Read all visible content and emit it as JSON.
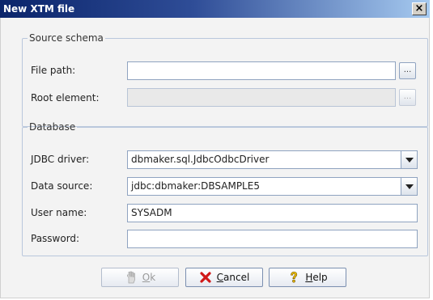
{
  "window": {
    "title": "New XTM file",
    "close_label": "×"
  },
  "source_schema": {
    "legend": "Source schema",
    "file_path_label": "File path:",
    "file_path_value": "",
    "root_element_label": "Root element:",
    "root_element_value": "",
    "browse_label": "..."
  },
  "database": {
    "legend": "Database",
    "jdbc_driver_label": "JDBC driver:",
    "jdbc_driver_value": "dbmaker.sql.JdbcOdbcDriver",
    "data_source_label": "Data source:",
    "data_source_value": "jdbc:dbmaker:DBSAMPLE5",
    "user_name_label": "User name:",
    "user_name_value": "SYSADM",
    "password_label": "Password:",
    "password_value": ""
  },
  "buttons": {
    "ok_mnemonic": "O",
    "ok_rest": "k",
    "cancel_mnemonic": "C",
    "cancel_rest": "ancel",
    "help_mnemonic": "H",
    "help_rest": "elp"
  },
  "icons": {
    "ok": "hand-icon",
    "cancel": "red-x-icon",
    "help": "question-icon"
  }
}
